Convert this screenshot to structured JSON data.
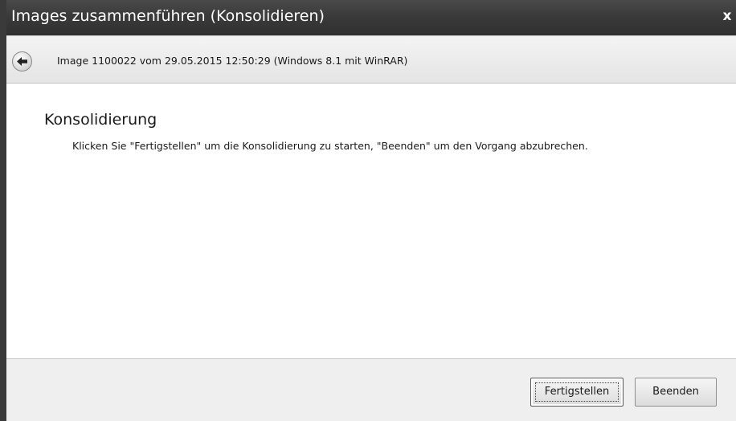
{
  "window": {
    "title": "Images zusammenführen (Konsolidieren)",
    "close_label": "x"
  },
  "navbar": {
    "back_icon": "back-arrow-icon",
    "image_info": "Image 1100022 vom 29.05.2015 12:50:29 (Windows 8.1 mit WinRAR)"
  },
  "content": {
    "heading": "Konsolidierung",
    "instructions": "Klicken Sie \"Fertigstellen\" um die Konsolidierung zu starten, \"Beenden\" um den Vorgang abzubrechen."
  },
  "footer": {
    "finish_label": "Fertigstellen",
    "cancel_label": "Beenden"
  },
  "colors": {
    "titlebar": "#3a3a3a",
    "footer": "#efefef",
    "navbar": "#ececec"
  }
}
